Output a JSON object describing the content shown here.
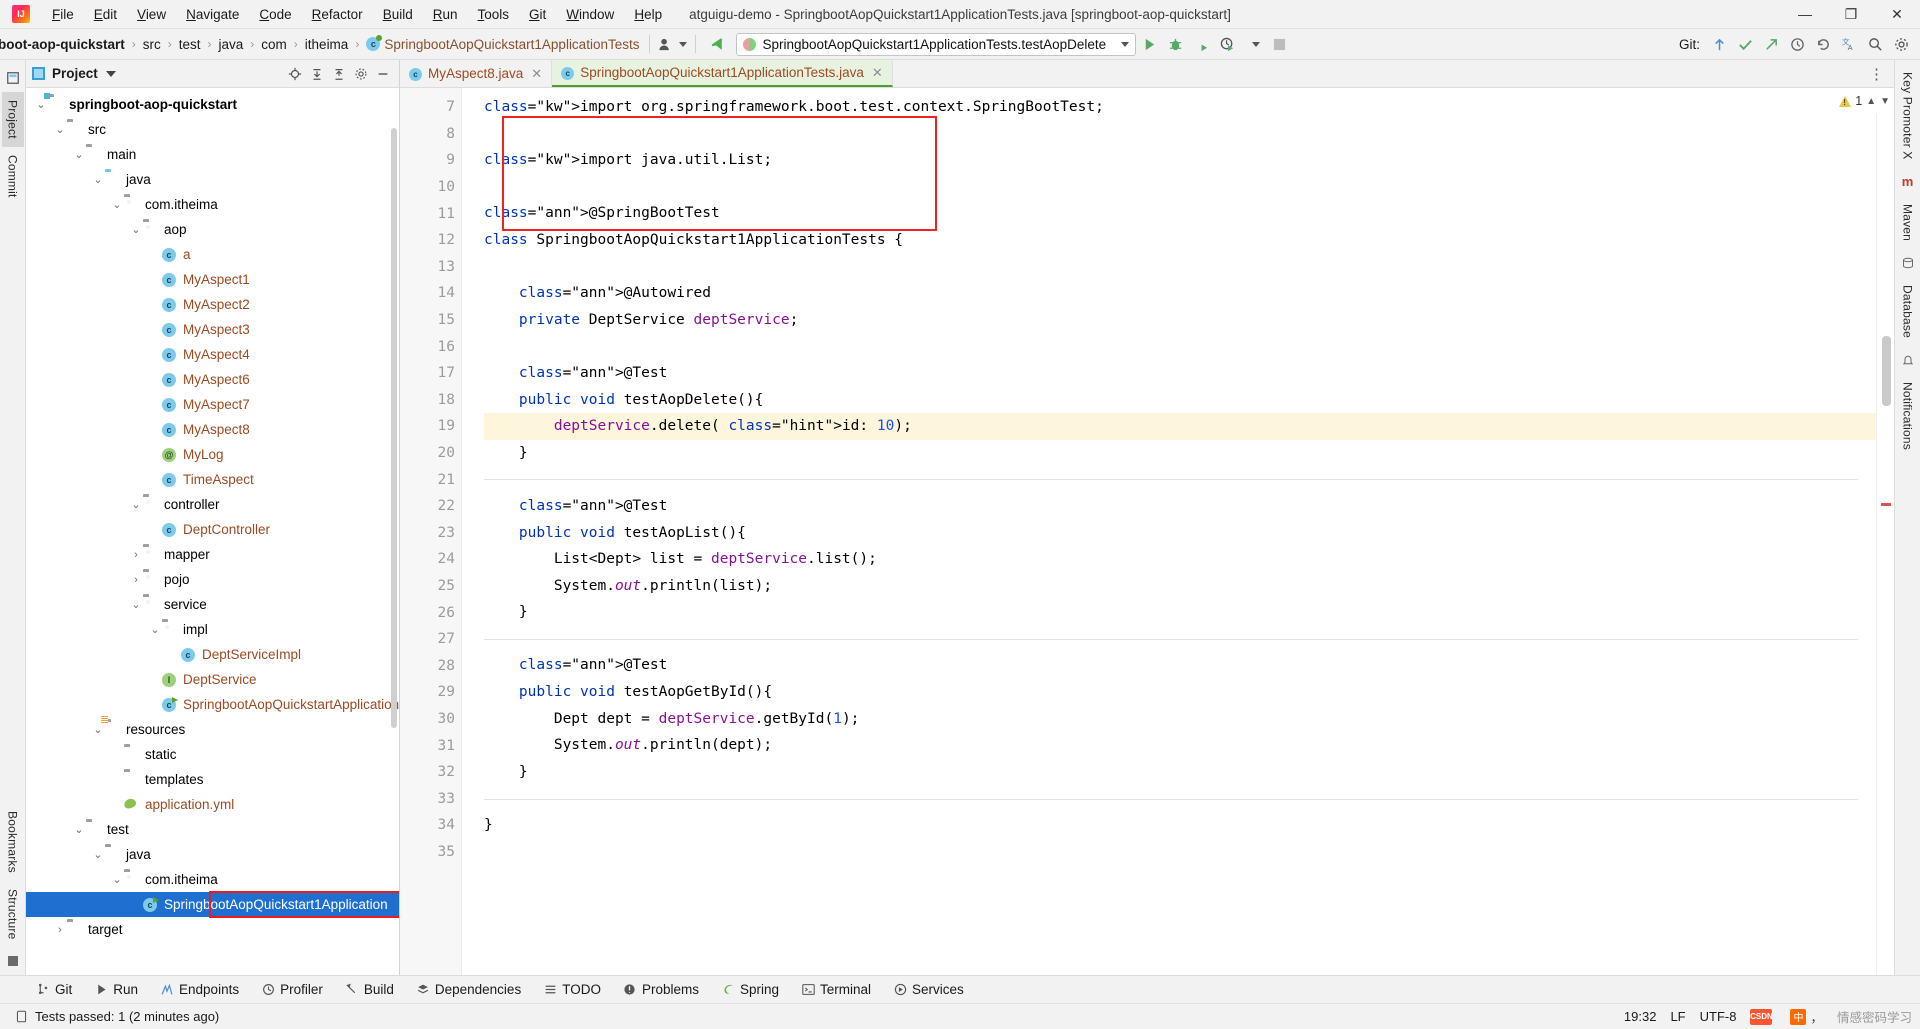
{
  "window": {
    "title": "atguigu-demo - SpringbootAopQuickstart1ApplicationTests.java [springboot-aop-quickstart]",
    "minimize": "—",
    "maximize": "❐",
    "close": "✕"
  },
  "menu": [
    "File",
    "Edit",
    "View",
    "Navigate",
    "Code",
    "Refactor",
    "Build",
    "Run",
    "Tools",
    "Git",
    "Window",
    "Help"
  ],
  "breadcrumb": {
    "items": [
      "boot-aop-quickstart",
      "src",
      "test",
      "java",
      "com",
      "itheima"
    ],
    "class": "SpringbootAopQuickstart1ApplicationTests",
    "separator": "›"
  },
  "toolbar": {
    "run_config": "SpringbootAopQuickstart1ApplicationTests.testAopDelete",
    "run_button": "run-button",
    "debug_button": "debug-button",
    "run_coverage_button": "run-with-coverage-button",
    "profiler_button": "profile-button",
    "stop_button": "stop-button",
    "git_label": "Git:",
    "git_update": "update-project-icon",
    "git_commit": "commit-icon",
    "git_push": "push-icon",
    "history": "history-icon",
    "undo": "undo-icon",
    "translate": "translate-icon",
    "search": "search-icon",
    "settings": "settings-icon",
    "avatar": "avatar-icon"
  },
  "project_panel": {
    "title": "Project",
    "actions": [
      "locate-icon",
      "expand-all-icon",
      "collapse-all-icon",
      "settings-icon",
      "hide-icon"
    ],
    "tree": [
      {
        "label": "springboot-aop-quickstart",
        "depth": 0,
        "arrow": "open",
        "icon": "module",
        "style": "bold"
      },
      {
        "label": "src",
        "depth": 1,
        "arrow": "open",
        "icon": "folder"
      },
      {
        "label": "main",
        "depth": 2,
        "arrow": "open",
        "icon": "folder"
      },
      {
        "label": "java",
        "depth": 3,
        "arrow": "open",
        "icon": "src-folder"
      },
      {
        "label": "com.itheima",
        "depth": 4,
        "arrow": "open",
        "icon": "package"
      },
      {
        "label": "aop",
        "depth": 5,
        "arrow": "open",
        "icon": "package"
      },
      {
        "label": "a",
        "depth": 6,
        "arrow": "none",
        "icon": "class",
        "style": "java"
      },
      {
        "label": "MyAspect1",
        "depth": 6,
        "arrow": "none",
        "icon": "class",
        "style": "java"
      },
      {
        "label": "MyAspect2",
        "depth": 6,
        "arrow": "none",
        "icon": "class",
        "style": "java"
      },
      {
        "label": "MyAspect3",
        "depth": 6,
        "arrow": "none",
        "icon": "class",
        "style": "java"
      },
      {
        "label": "MyAspect4",
        "depth": 6,
        "arrow": "none",
        "icon": "class",
        "style": "java"
      },
      {
        "label": "MyAspect6",
        "depth": 6,
        "arrow": "none",
        "icon": "class",
        "style": "java"
      },
      {
        "label": "MyAspect7",
        "depth": 6,
        "arrow": "none",
        "icon": "class",
        "style": "java"
      },
      {
        "label": "MyAspect8",
        "depth": 6,
        "arrow": "none",
        "icon": "class",
        "style": "java"
      },
      {
        "label": "MyLog",
        "depth": 6,
        "arrow": "none",
        "icon": "annotation",
        "style": "java"
      },
      {
        "label": "TimeAspect",
        "depth": 6,
        "arrow": "none",
        "icon": "class",
        "style": "java"
      },
      {
        "label": "controller",
        "depth": 5,
        "arrow": "open",
        "icon": "package"
      },
      {
        "label": "DeptController",
        "depth": 6,
        "arrow": "none",
        "icon": "class",
        "style": "java"
      },
      {
        "label": "mapper",
        "depth": 5,
        "arrow": "closed",
        "icon": "package"
      },
      {
        "label": "pojo",
        "depth": 5,
        "arrow": "closed",
        "icon": "package"
      },
      {
        "label": "service",
        "depth": 5,
        "arrow": "open",
        "icon": "package"
      },
      {
        "label": "impl",
        "depth": 6,
        "arrow": "open",
        "icon": "package"
      },
      {
        "label": "DeptServiceImpl",
        "depth": 7,
        "arrow": "none",
        "icon": "class",
        "style": "java"
      },
      {
        "label": "DeptService",
        "depth": 6,
        "arrow": "none",
        "icon": "interface",
        "style": "java"
      },
      {
        "label": "SpringbootAopQuickstartApplication",
        "depth": 6,
        "arrow": "none",
        "icon": "spring-run",
        "style": "java"
      },
      {
        "label": "resources",
        "depth": 3,
        "arrow": "open",
        "icon": "resource-folder"
      },
      {
        "label": "static",
        "depth": 4,
        "arrow": "none",
        "icon": "folder"
      },
      {
        "label": "templates",
        "depth": 4,
        "arrow": "none",
        "icon": "folder"
      },
      {
        "label": "application.yml",
        "depth": 4,
        "arrow": "none",
        "icon": "yaml",
        "style": "java"
      },
      {
        "label": "test",
        "depth": 2,
        "arrow": "open",
        "icon": "folder"
      },
      {
        "label": "java",
        "depth": 3,
        "arrow": "open",
        "icon": "test-folder"
      },
      {
        "label": "com.itheima",
        "depth": 4,
        "arrow": "open",
        "icon": "package"
      },
      {
        "label": "SpringbootAopQuickstart1Application",
        "depth": 5,
        "arrow": "none",
        "icon": "spring-run",
        "style": "java",
        "selected": true
      },
      {
        "label": "target",
        "depth": 1,
        "arrow": "closed",
        "icon": "folder"
      }
    ]
  },
  "left_rail": [
    "Project",
    "Commit",
    "Bookmarks",
    "Structure"
  ],
  "right_rail": [
    "Key Promoter X",
    "Maven",
    "Database",
    "Notifications"
  ],
  "editor": {
    "tabs": [
      {
        "label": "MyAspect8.java",
        "active": false,
        "icon": "class-icon"
      },
      {
        "label": "SpringbootAopQuickstart1ApplicationTests.java",
        "active": true,
        "icon": "class-icon"
      }
    ],
    "warning_count": "1",
    "lines": [
      {
        "n": 7,
        "marker": "",
        "fold": "",
        "code": "import org.springframework.boot.test.context.SpringBootTest;"
      },
      {
        "n": 8,
        "marker": "",
        "fold": "",
        "code": ""
      },
      {
        "n": 9,
        "marker": "",
        "fold": "fold",
        "code": "import java.util.List;"
      },
      {
        "n": 10,
        "marker": "",
        "fold": "",
        "code": ""
      },
      {
        "n": 11,
        "marker": "leaf",
        "fold": "",
        "code": "@SpringBootTest"
      },
      {
        "n": 12,
        "marker": "run",
        "fold": "",
        "code": "class SpringbootAopQuickstart1ApplicationTests {"
      },
      {
        "n": 13,
        "marker": "",
        "fold": "",
        "code": ""
      },
      {
        "n": 14,
        "marker": "",
        "fold": "",
        "code": "    @Autowired"
      },
      {
        "n": 15,
        "marker": "bean",
        "fold": "",
        "code": "    private DeptService deptService;"
      },
      {
        "n": 16,
        "marker": "",
        "fold": "",
        "code": ""
      },
      {
        "n": 17,
        "marker": "",
        "fold": "",
        "code": "    @Test"
      },
      {
        "n": 18,
        "marker": "run",
        "fold": "fold",
        "code": "    public void testAopDelete(){"
      },
      {
        "n": 19,
        "marker": "",
        "fold": "",
        "code": "        deptService.delete( id: 10);",
        "highlight": true
      },
      {
        "n": 20,
        "marker": "",
        "fold": "foldend",
        "code": "    }"
      },
      {
        "n": 21,
        "marker": "",
        "fold": "",
        "code": ""
      },
      {
        "n": 22,
        "marker": "",
        "fold": "",
        "code": "    @Test"
      },
      {
        "n": 23,
        "marker": "runfail",
        "fold": "fold",
        "code": "    public void testAopList(){"
      },
      {
        "n": 24,
        "marker": "",
        "fold": "",
        "code": "        List<Dept> list = deptService.list();"
      },
      {
        "n": 25,
        "marker": "",
        "fold": "",
        "code": "        System.out.println(list);"
      },
      {
        "n": 26,
        "marker": "",
        "fold": "foldend",
        "code": "    }"
      },
      {
        "n": 27,
        "marker": "",
        "fold": "",
        "code": ""
      },
      {
        "n": 28,
        "marker": "",
        "fold": "",
        "code": "    @Test"
      },
      {
        "n": 29,
        "marker": "run",
        "fold": "fold",
        "code": "    public void testAopGetById(){"
      },
      {
        "n": 30,
        "marker": "",
        "fold": "",
        "code": "        Dept dept = deptService.getById(1);"
      },
      {
        "n": 31,
        "marker": "",
        "fold": "",
        "code": "        System.out.println(dept);"
      },
      {
        "n": 32,
        "marker": "",
        "fold": "foldend",
        "code": "    }"
      },
      {
        "n": 33,
        "marker": "",
        "fold": "",
        "code": ""
      },
      {
        "n": 34,
        "marker": "",
        "fold": "",
        "code": "}"
      },
      {
        "n": 35,
        "marker": "",
        "fold": "",
        "code": ""
      }
    ]
  },
  "bottom_bar": [
    {
      "label": "Git",
      "icon": "git-icon"
    },
    {
      "label": "Run",
      "icon": "run-icon"
    },
    {
      "label": "Endpoints",
      "icon": "endpoints-icon"
    },
    {
      "label": "Profiler",
      "icon": "profiler-icon"
    },
    {
      "label": "Build",
      "icon": "build-icon"
    },
    {
      "label": "Dependencies",
      "icon": "dependencies-icon"
    },
    {
      "label": "TODO",
      "icon": "todo-icon"
    },
    {
      "label": "Problems",
      "icon": "problems-icon"
    },
    {
      "label": "Spring",
      "icon": "spring-icon"
    },
    {
      "label": "Terminal",
      "icon": "terminal-icon"
    },
    {
      "label": "Services",
      "icon": "services-icon"
    }
  ],
  "status": {
    "message": "Tests passed: 1 (2 minutes ago)",
    "message_icon": "test-status-icon",
    "time": "19:32",
    "line_sep": "LF",
    "encoding": "UTF-8",
    "csdn": "CSDN",
    "watermark": "情感密码学习",
    "ime_lang": "中",
    "ime_punct": "，"
  }
}
